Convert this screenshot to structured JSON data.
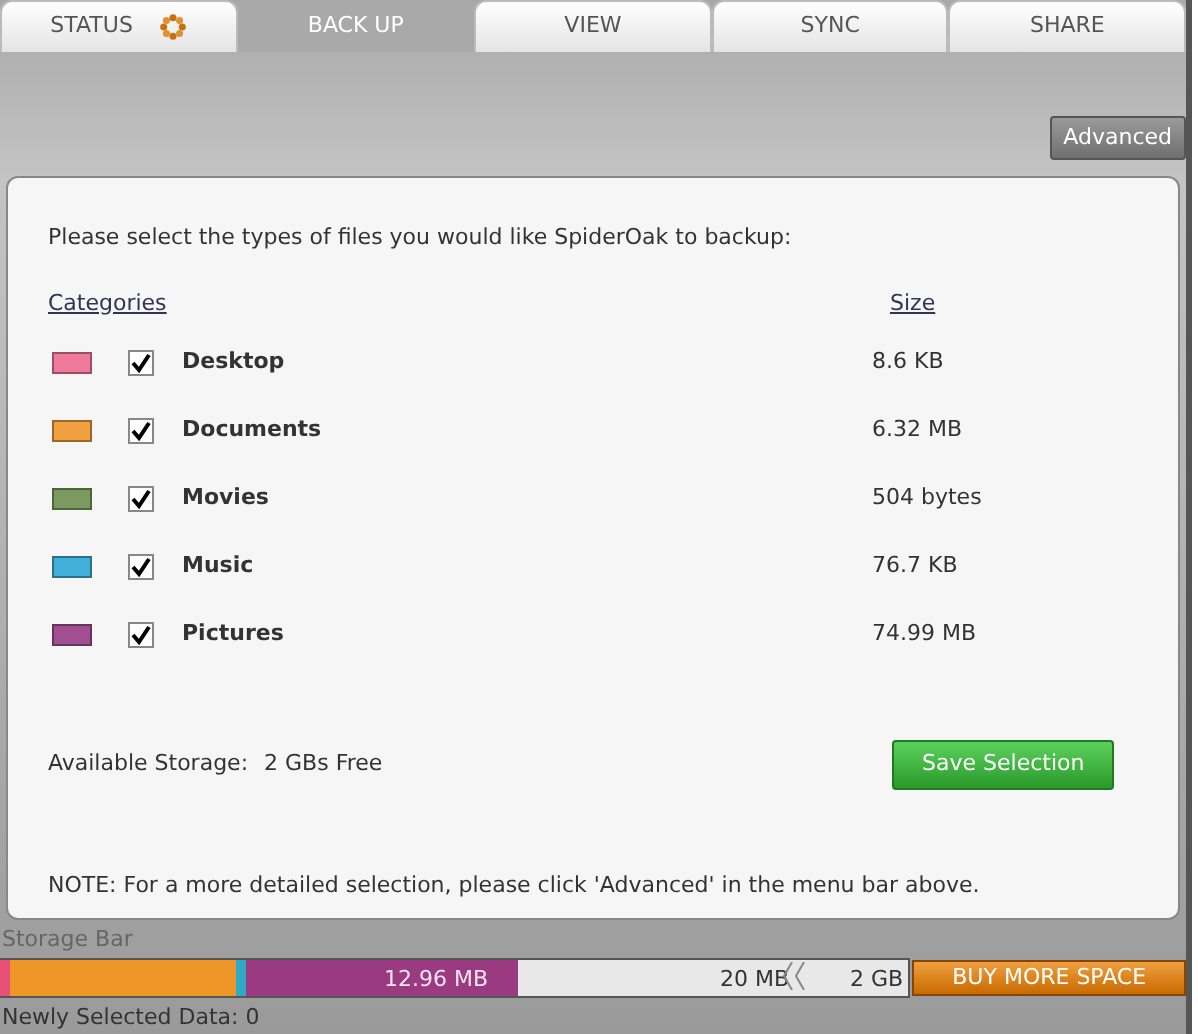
{
  "tabs": [
    {
      "label": "STATUS",
      "selected": false,
      "busy": true
    },
    {
      "label": "BACK UP",
      "selected": true,
      "busy": false
    },
    {
      "label": "VIEW",
      "selected": false,
      "busy": false
    },
    {
      "label": "SYNC",
      "selected": false,
      "busy": false
    },
    {
      "label": "SHARE",
      "selected": false,
      "busy": false
    }
  ],
  "advanced_button": "Advanced",
  "intro": "Please select the types of files you would like SpiderOak to backup:",
  "columns": [
    "Categories",
    "Size"
  ],
  "categories": [
    {
      "name": "Desktop",
      "size": "8.6 KB",
      "checked": true,
      "color": "#f07a9a"
    },
    {
      "name": "Documents",
      "size": "6.32 MB",
      "checked": true,
      "color": "#f0a040"
    },
    {
      "name": "Movies",
      "size": "504 bytes",
      "checked": true,
      "color": "#7a9a60"
    },
    {
      "name": "Music",
      "size": "76.7 KB",
      "checked": true,
      "color": "#40b0d8"
    },
    {
      "name": "Pictures",
      "size": "74.99 MB",
      "checked": true,
      "color": "#a05090"
    }
  ],
  "available_label": "Available Storage:",
  "available_value": "2 GBs Free",
  "save_button": "Save Selection",
  "note": "NOTE: For a more detailed selection, please click 'Advanced' in the menu bar above.",
  "storage_bar": {
    "title": "Storage Bar",
    "used_label": "12.96 MB",
    "mid_label": "20 MB",
    "end_label": "2 GB",
    "segments": [
      {
        "color": "#e8507a"
      },
      {
        "color": "#ee9628"
      },
      {
        "color": "#30a8c8"
      },
      {
        "color": "#9a3a80"
      }
    ]
  },
  "buy_button": "BUY MORE SPACE",
  "newly_selected": "Newly Selected Data: 0"
}
